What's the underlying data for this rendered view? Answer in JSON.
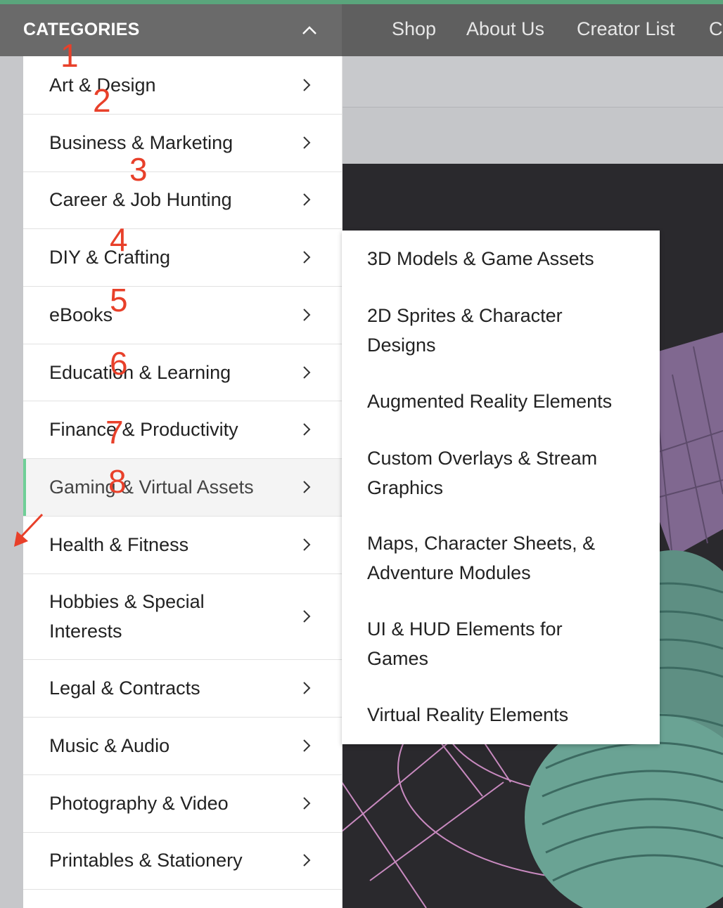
{
  "header": {
    "categories_label": "CATEGORIES",
    "nav_links": [
      "Shop",
      "About Us",
      "Creator List",
      "C"
    ]
  },
  "menu": {
    "items": [
      {
        "label": "Art & Design"
      },
      {
        "label": "Business & Marketing"
      },
      {
        "label": "Career & Job Hunting"
      },
      {
        "label": "DIY & Crafting"
      },
      {
        "label": "eBooks"
      },
      {
        "label": "Education & Learning"
      },
      {
        "label": "Finance & Productivity"
      },
      {
        "label": "Gaming & Virtual Assets"
      },
      {
        "label": "Health & Fitness"
      },
      {
        "label": "Hobbies & Special Interests"
      },
      {
        "label": "Legal & Contracts"
      },
      {
        "label": "Music & Audio"
      },
      {
        "label": "Photography & Video"
      },
      {
        "label": "Printables & Stationery"
      }
    ],
    "active_item": "Gaming & Virtual Assets"
  },
  "submenu": {
    "items": [
      {
        "label": "3D Models & Game Assets"
      },
      {
        "label": "2D Sprites & Character Designs"
      },
      {
        "label": "Augmented Reality Elements"
      },
      {
        "label": "Custom Overlays & Stream Graphics"
      },
      {
        "label": "Maps, Character Sheets, & Adventure Modules"
      },
      {
        "label": "UI & HUD Elements for Games"
      },
      {
        "label": "Virtual Reality Elements"
      }
    ]
  },
  "annotations": [
    "1",
    "2",
    "3",
    "4",
    "5",
    "6",
    "7",
    "8"
  ],
  "colors": {
    "accent_green": "#6fcf97",
    "annotation_red": "#e8402a",
    "header_bg": "#5f5f5f"
  }
}
